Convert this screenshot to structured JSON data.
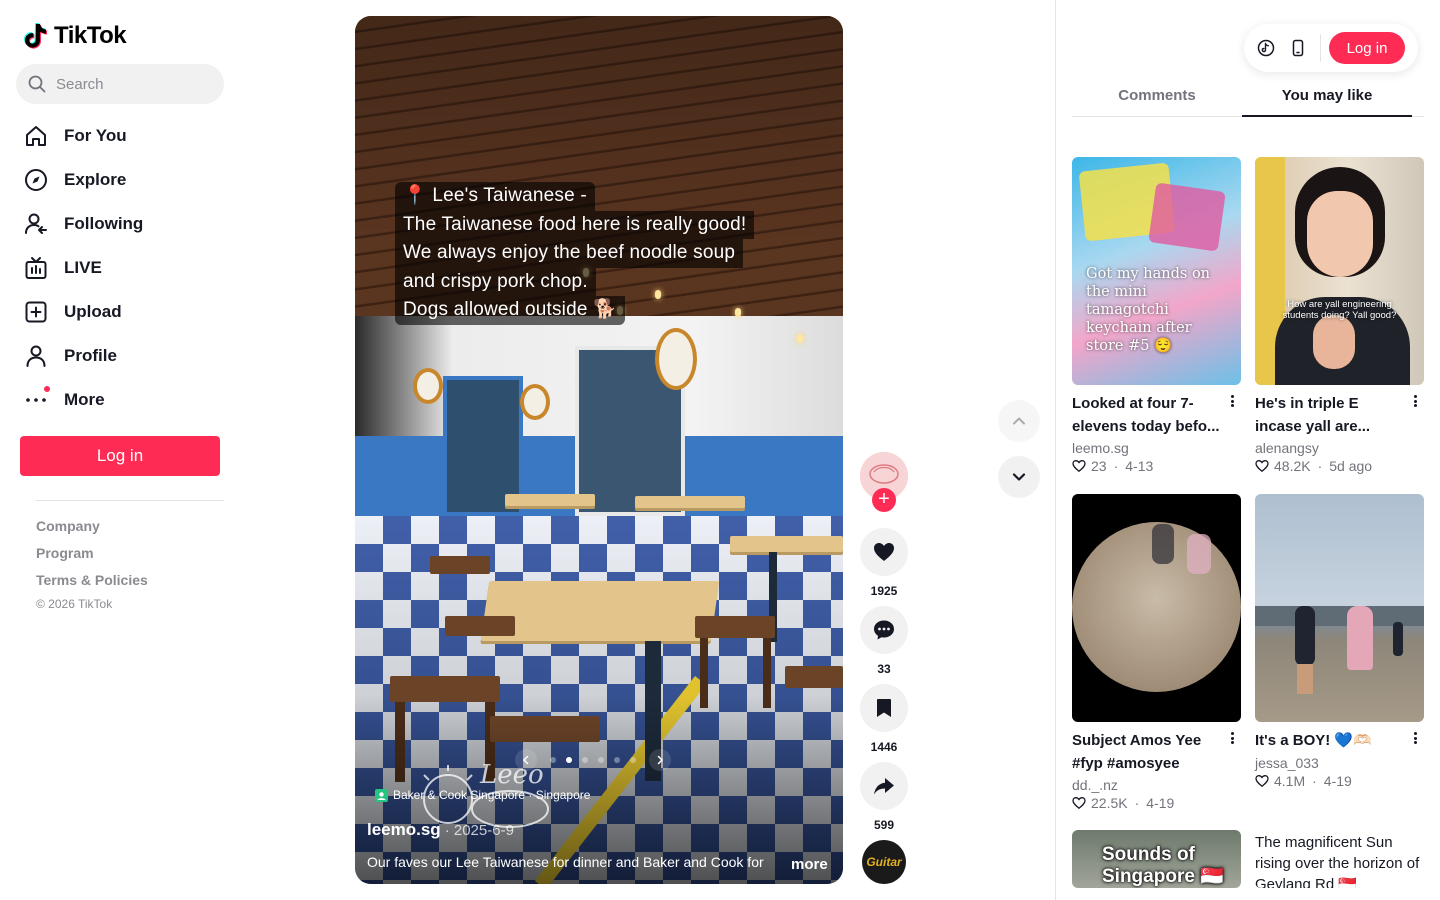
{
  "brand": {
    "name": "TikTok"
  },
  "search": {
    "placeholder": "Search"
  },
  "nav": {
    "items": [
      {
        "label": "For You",
        "icon": "home-icon"
      },
      {
        "label": "Explore",
        "icon": "compass-icon"
      },
      {
        "label": "Following",
        "icon": "following-icon"
      },
      {
        "label": "LIVE",
        "icon": "live-icon"
      },
      {
        "label": "Upload",
        "icon": "upload-icon"
      },
      {
        "label": "Profile",
        "icon": "profile-icon"
      },
      {
        "label": "More",
        "icon": "more-icon"
      }
    ]
  },
  "sidebar": {
    "login_label": "Log in",
    "footer_links": [
      "Company",
      "Program",
      "Terms & Policies"
    ],
    "copyright": "© 2026 TikTok"
  },
  "video": {
    "caption_lines": [
      "📍 Lee's Taiwanese -",
      "The Taiwanese food here is really good!",
      "We always enjoy the beef noodle soup",
      "and crispy pork chop.",
      "Dogs allowed outside 🐕"
    ],
    "location": "Baker & Cook Singapore · Singapore",
    "author": "leemo.sg",
    "date": "· 2025-6-9",
    "description": "Our faves our Lee Taiwanese for dinner and Baker and Cook for",
    "more_label": "more",
    "carousel": {
      "count": 6,
      "active_index": 1
    },
    "watermark": "Leeo"
  },
  "actions": {
    "likes": "1925",
    "comments": "33",
    "saves": "1446",
    "shares": "599",
    "follow_symbol": "+",
    "music_label": "Guitar"
  },
  "right_panel": {
    "login_label": "Log in",
    "tabs": [
      {
        "label": "Comments",
        "active": false
      },
      {
        "label": "You may like",
        "active": true
      }
    ],
    "cards": [
      {
        "title": "Looked at four 7-elevens today befo...",
        "author": "leemo.sg",
        "likes": "23",
        "date": "4-13",
        "thumb_text": "Got my hands on the mini tamagotchi keychain after store #5 😌"
      },
      {
        "title": "He's in triple E incase yall are...",
        "author": "alenangsy",
        "likes": "48.2K",
        "date": "5d ago",
        "thumb_text": "How are yall engineering students doing? Yall good?"
      },
      {
        "title": "Subject Amos Yee #fyp #amosyee",
        "author": "dd._.nz",
        "likes": "22.5K",
        "date": "4-19"
      },
      {
        "title": "It's a BOY! 💙🫶🏻",
        "author": "jessa_033",
        "likes": "4.1M",
        "date": "4-19"
      }
    ],
    "partial_cards": [
      {
        "thumb_text": "Sounds of Singapore 🇸🇬"
      },
      {
        "alt_text": "The magnificent Sun rising over the horizon of Geylang Rd 🇸🇬"
      }
    ]
  },
  "colors": {
    "accent": "#fe2c55",
    "text": "#161823",
    "muted": "#8a8b91"
  }
}
